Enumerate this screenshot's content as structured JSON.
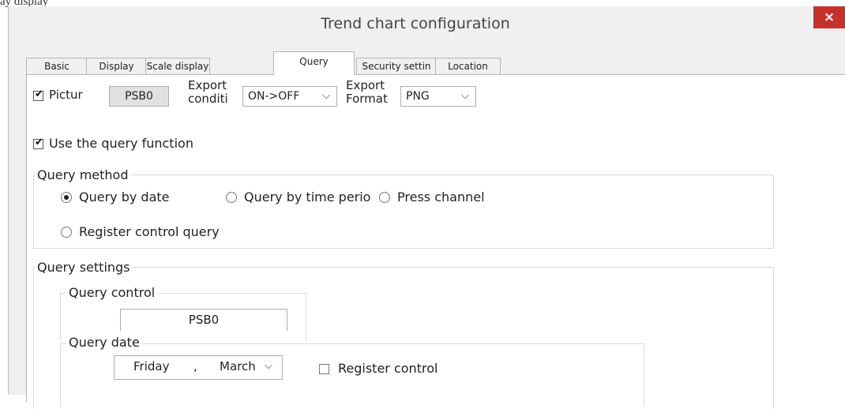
{
  "top_text": "ay display",
  "window": {
    "title": "Trend chart configuration",
    "close_symbol": "×"
  },
  "tabs": [
    {
      "label": "Basic Attribute"
    },
    {
      "label": "Display"
    },
    {
      "label": "Scale display"
    },
    {
      "label": "Query",
      "active": true
    },
    {
      "label": "Security settin"
    },
    {
      "label": "Location"
    }
  ],
  "picture": {
    "label": "Pictur",
    "checked": true,
    "button_label": "PSB0"
  },
  "export_condition": {
    "label_line1": "Export",
    "label_line2": "conditi",
    "value": "ON->OFF"
  },
  "export_format": {
    "label_line1": "Export",
    "label_line2": "Format",
    "value": "PNG"
  },
  "use_query": {
    "label": "Use the query function",
    "checked": true
  },
  "query_method": {
    "title": "Query method",
    "options": [
      {
        "label": "Query by date",
        "selected": true
      },
      {
        "label": "Query by time perio",
        "selected": false
      },
      {
        "label": "Press channel",
        "selected": false
      },
      {
        "label": "Register control query",
        "selected": false
      }
    ]
  },
  "query_settings": {
    "title": "Query settings",
    "query_control": {
      "title": "Query control",
      "value": "PSB0"
    },
    "query_date": {
      "title": "Query date",
      "day": "Friday",
      "separator": ",",
      "month": "March",
      "register_control": {
        "label": "Register control",
        "checked": false
      }
    }
  },
  "icons": {
    "checkmark": "check-icon",
    "dropdown": "chevron-down-icon",
    "close": "close-icon"
  }
}
